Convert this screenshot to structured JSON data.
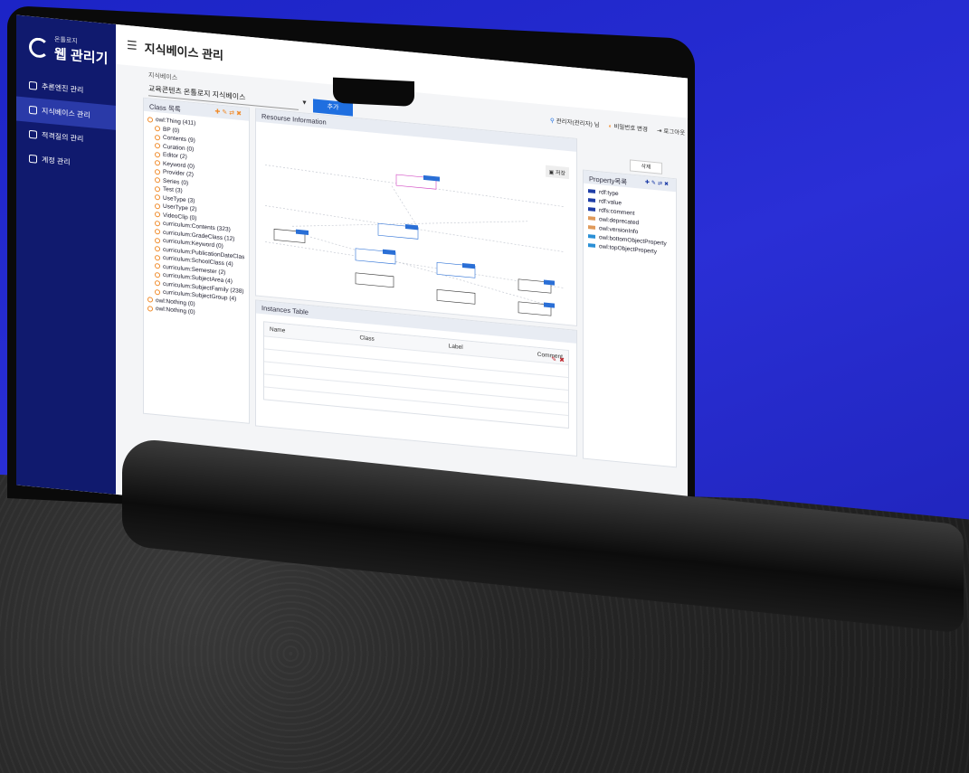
{
  "sidebar": {
    "logo_small": "온톨로지",
    "logo_title": "웹 관리기",
    "items": [
      {
        "label": "추론엔진 관리"
      },
      {
        "label": "지식베이스 관리"
      },
      {
        "label": "적격질의 관리"
      },
      {
        "label": "계정 관리"
      }
    ]
  },
  "header": {
    "title": "지식베이스 관리"
  },
  "kb": {
    "label": "지식베이스",
    "selected": "교육콘텐츠 온톨로지 지식베이스",
    "add_label": "추가"
  },
  "user": {
    "name": "관리자(관리자) 님",
    "change_password": "비밀번호 변경",
    "logout": "로그아웃"
  },
  "class_panel": {
    "title": "Class 목록",
    "tree": [
      "owl:Thing (411)",
      "BP (0)",
      "Contents (9)",
      "Curation (0)",
      "Editor (2)",
      "Keyword (0)",
      "Provider (2)",
      "Series (0)",
      "Test (3)",
      "UseType (3)",
      "UserType (2)",
      "VideoClip (0)",
      "curriculum:Contents (323)",
      "curriculum:GradeClass (12)",
      "curriculum:Keyword (0)",
      "curriculum:PublicationDateClas",
      "curriculum:SchoolClass (4)",
      "curriculum:Semester (2)",
      "curriculum:SubjectArea (4)",
      "curriculum:SubjectFamily (238)",
      "curriculum:SubjectGroup (4)",
      "owl:Nothing (0)",
      "owl:Nothing (0)"
    ]
  },
  "resource_panel": {
    "title": "Resourse Information",
    "save_label": "저장"
  },
  "delete_label": "삭제",
  "property_panel": {
    "title": "Property목록",
    "items": [
      {
        "label": "rdf:type",
        "color": "#1f3ea8"
      },
      {
        "label": "rdf:value",
        "color": "#1f3ea8"
      },
      {
        "label": "rdfs:comment",
        "color": "#1f3ea8"
      },
      {
        "label": "owl:deprecated",
        "color": "#e09a5a"
      },
      {
        "label": "owl:versionInfo",
        "color": "#e09a5a"
      },
      {
        "label": "owl:bottomObjectProperty",
        "color": "#2a8fd6"
      },
      {
        "label": "owl:topObjectProperty",
        "color": "#2a8fd6"
      }
    ]
  },
  "instances": {
    "title": "Instances Table",
    "columns": [
      "Name",
      "Class",
      "Label",
      "Comment"
    ]
  }
}
